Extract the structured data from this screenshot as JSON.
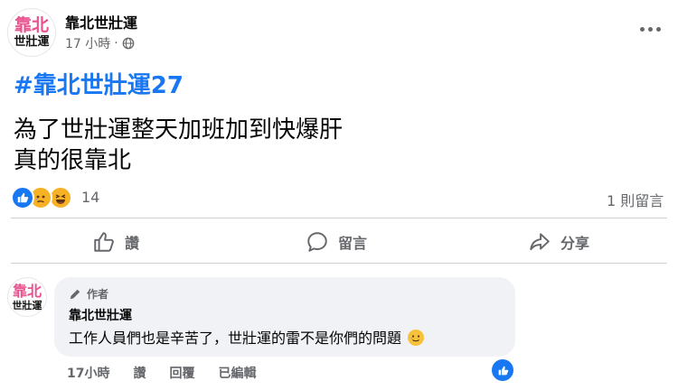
{
  "post": {
    "page_name": "靠北世壯運",
    "avatar_line1": "靠北",
    "avatar_line2": "世壯運",
    "time": "17 小時",
    "separator": "·",
    "hashtag": "#靠北世壯運27",
    "body_line1": "為了世壯運整天加班加到快爆肝",
    "body_line2": "真的很靠北",
    "reaction_count": "14",
    "comment_count": "1 則留言",
    "more_icon": "more-dots-icon",
    "privacy_icon": "globe-icon"
  },
  "actions": {
    "like": "讚",
    "comment": "留言",
    "share": "分享"
  },
  "comment": {
    "avatar_line1": "靠北",
    "avatar_line2": "世壯運",
    "badge": "作者",
    "author": "靠北世壯運",
    "text": "工作人員們也是辛苦了，世壯運的雷不是你們的問題",
    "time": "17小時",
    "like": "讚",
    "reply": "回覆",
    "edited": "已編輯"
  },
  "colors": {
    "accent": "#1877f2",
    "muted": "#65676b",
    "avatar_pink": "#e8538f"
  }
}
